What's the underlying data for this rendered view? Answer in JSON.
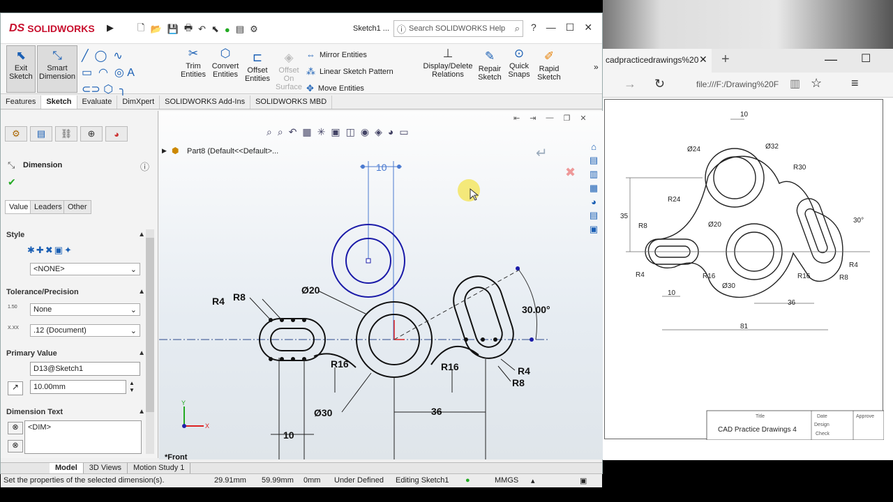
{
  "app": {
    "logo": "SOLIDWORKS",
    "doc_title": "Sketch1 ...",
    "search_placeholder": "Search SOLIDWORKS Help",
    "help": "?"
  },
  "ribbon": {
    "exit_sketch": "Exit Sketch",
    "smart_dimension": "Smart Dimension",
    "trim": "Trim Entities",
    "convert": "Convert Entities",
    "offset": "Offset Entities",
    "offset_surface": "Offset On Surface",
    "mirror": "Mirror Entities",
    "linear_pattern": "Linear Sketch Pattern",
    "move": "Move Entities",
    "display_delete": "Display/Delete Relations",
    "repair": "Repair Sketch",
    "quick_snaps": "Quick Snaps",
    "rapid": "Rapid Sketch"
  },
  "tabs": [
    "Features",
    "Sketch",
    "Evaluate",
    "DimXpert",
    "SOLIDWORKS Add-Ins",
    "SOLIDWORKS MBD"
  ],
  "active_tab": "Sketch",
  "panel": {
    "title": "Dimension",
    "subtabs": [
      "Value",
      "Leaders",
      "Other"
    ],
    "style_label": "Style",
    "style_value": "<NONE>",
    "tolerance_label": "Tolerance/Precision",
    "tolerance_value": "None",
    "precision_value": ".12 (Document)",
    "tol_icon_a": "1.50",
    "tol_icon_b": "X.XX",
    "primary_label": "Primary Value",
    "primary_name": "D13@Sketch1",
    "primary_value": "10.00mm",
    "dimtext_label": "Dimension Text",
    "dimtext_value": "<DIM>"
  },
  "graphics": {
    "tree_item": "Part8  (Default<<Default>...",
    "view_label": "*Front",
    "dims": {
      "top": "10",
      "r4_left": "R4",
      "r8_left": "R8",
      "d20": "Ø20",
      "angle": "30.00°",
      "r16_left": "R16",
      "r16_right": "R16",
      "r4_right": "R4",
      "r8_right": "R8",
      "d30": "Ø30",
      "d36": "36",
      "d10": "10"
    },
    "axis_y": "Y",
    "axis_x": "X"
  },
  "bottom_tabs": [
    "Model",
    "3D Views",
    "Motion Study 1"
  ],
  "status": {
    "message": "Set the properties of the selected dimension(s).",
    "x": "29.91mm",
    "y": "59.99mm",
    "z": "0mm",
    "state": "Under Defined",
    "editing": "Editing Sketch1",
    "units": "MMGS"
  },
  "browser": {
    "tab_title": "cadpracticedrawings%20",
    "address": "file:///F:/Drawing%20F",
    "drawing": {
      "dims": {
        "d10": "10",
        "d24": "Ø24",
        "d32": "Ø32",
        "r30": "R30",
        "r24": "R24",
        "d35": "35",
        "r8a": "R8",
        "d20": "Ø20",
        "d30deg": "30°",
        "r4a": "R4",
        "r16a": "R16",
        "d30": "Ø30",
        "r16b": "R16",
        "r4b": "R4",
        "r8b": "R8",
        "d10b": "10",
        "d36": "36",
        "d81": "81"
      },
      "title_block": {
        "title_label": "Title",
        "title": "CAD Practice Drawings 4",
        "date": "Date",
        "design": "Design",
        "check": "Check",
        "approve": "Approve"
      }
    }
  },
  "colors": {
    "accent": "#c8102e",
    "sketch_blue": "#1a1aa8"
  }
}
